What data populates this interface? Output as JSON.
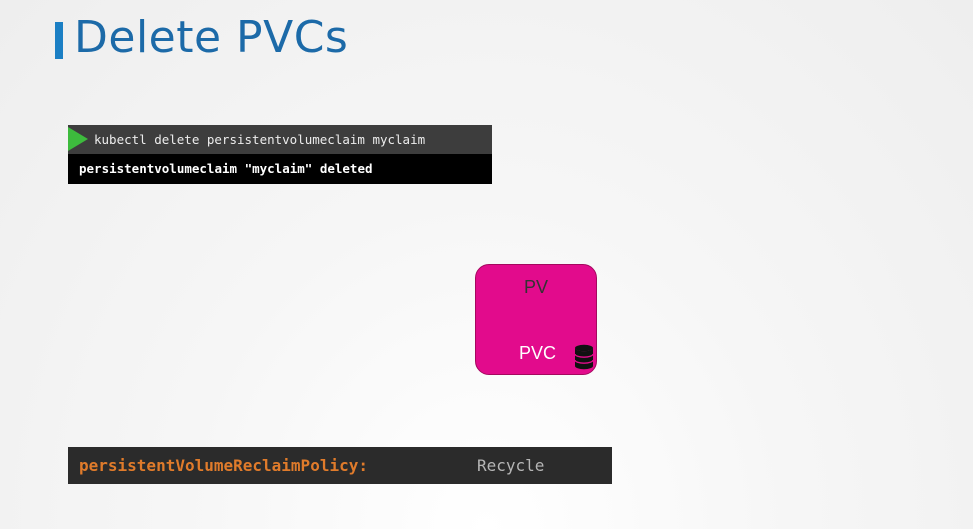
{
  "header": {
    "title": "Delete PVCs"
  },
  "terminal": {
    "command": "kubectl delete persistentvolumeclaim myclaim",
    "output": "persistentvolumeclaim \"myclaim\" deleted",
    "run_icon": "play-icon"
  },
  "diagram": {
    "pv_label": "PV",
    "pvc_label": "PVC",
    "pvc_icon": "database-icon",
    "pv_color": "#e20b8c"
  },
  "policy": {
    "key": "persistentVolumeReclaimPolicy:",
    "value": "Recycle",
    "key_color": "#e07b2b"
  },
  "colors": {
    "accent": "#1b7fc4",
    "title": "#1c6aa8"
  }
}
